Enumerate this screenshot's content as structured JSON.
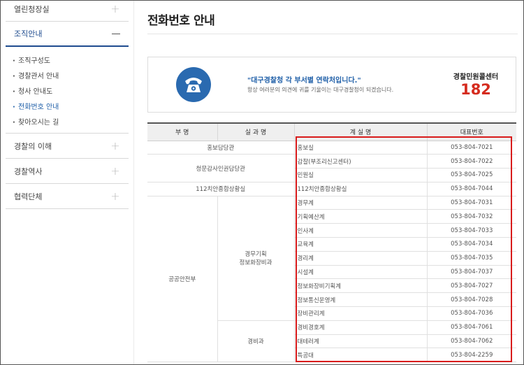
{
  "sidebar": {
    "top_item": "열린청장실",
    "active_item": "조직안내",
    "sub_items": [
      "조직구성도",
      "경찰관서 안내",
      "청사 안내도",
      "전화번호 안내",
      "찾아오시는 길"
    ],
    "lower_items": [
      "경찰의 이해",
      "경찰역사",
      "협력단체"
    ]
  },
  "main": {
    "title": "전화번호 안내",
    "info": {
      "quote": "\"대구경찰청 각 부서별 연락처입니다.\"",
      "description": "항상 여러분의 의견에 귀를 기울이는 대구경찰청이 되겠습니다.",
      "center_label": "경찰민원콜센터",
      "center_number": "182"
    }
  },
  "table": {
    "headers": [
      "부 명",
      "실 과 명",
      "계 실 명",
      "대표번호"
    ],
    "rows": [
      {
        "room": "홍보실",
        "phone": "053-804-7021"
      },
      {
        "room": "감찰(부조리신고센터)",
        "phone": "053-804-7022"
      },
      {
        "room": "민원실",
        "phone": "053-804-7025"
      },
      {
        "room": "112치안종합상황실",
        "phone": "053-804-7044"
      },
      {
        "room": "경무계",
        "phone": "053-804-7031"
      },
      {
        "room": "기획예산계",
        "phone": "053-804-7032"
      },
      {
        "room": "인사계",
        "phone": "053-804-7033"
      },
      {
        "room": "교육계",
        "phone": "053-804-7034"
      },
      {
        "room": "경리계",
        "phone": "053-804-7035"
      },
      {
        "room": "시설계",
        "phone": "053-804-7037"
      },
      {
        "room": "정보화장비기획계",
        "phone": "053-804-7027"
      },
      {
        "room": "정보통신운영계",
        "phone": "053-804-7028"
      },
      {
        "room": "장비관리계",
        "phone": "053-804-7036"
      },
      {
        "room": "경비경호계",
        "phone": "053-804-7061"
      },
      {
        "room": "대테러계",
        "phone": "053-804-7062"
      },
      {
        "room": "특공대",
        "phone": "053-804-2259"
      }
    ],
    "dept_groups": [
      "홍보담당관",
      "청문감사인권담당관",
      "112치안종합상황실",
      "공공안전부"
    ],
    "sub_groups": [
      "경무기획\n정보화장비과",
      "경비과"
    ]
  },
  "colors": {
    "accent_blue": "#1f5fa8",
    "call_red": "#d52b1e",
    "highlight_red": "#d81b1b"
  }
}
